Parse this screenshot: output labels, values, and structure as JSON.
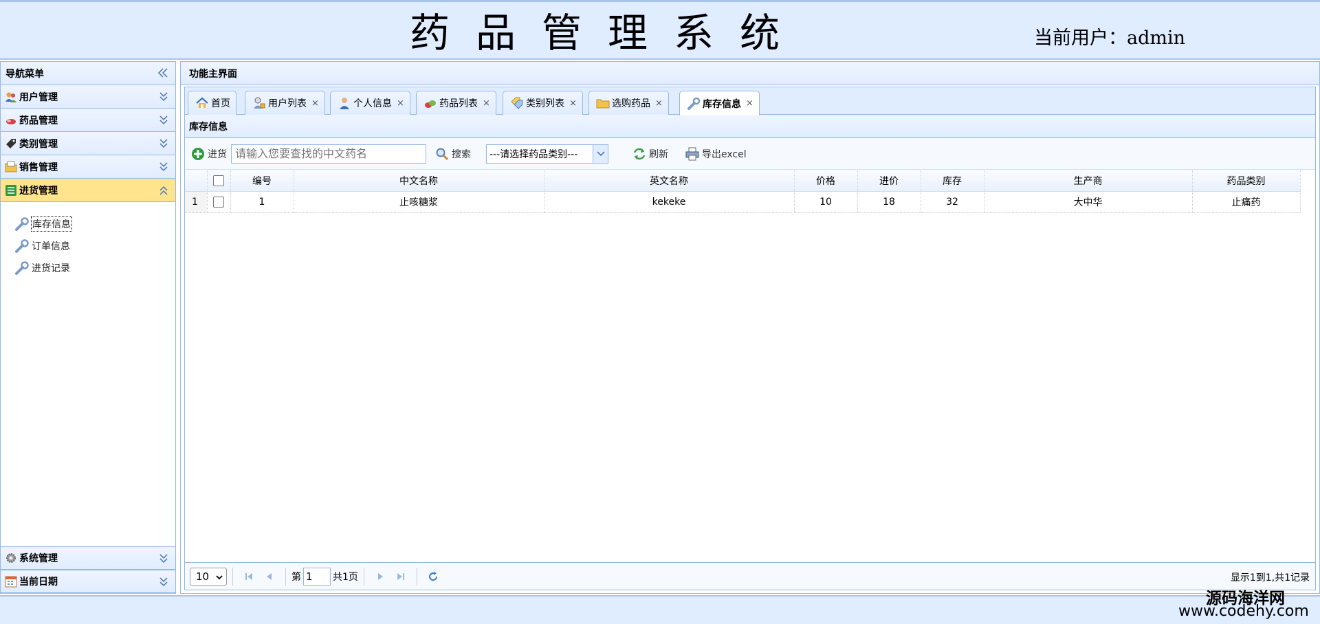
{
  "header": {
    "title": "药品管理系统",
    "current_user_label": "当前用户：admin"
  },
  "nav": {
    "title": "导航菜单",
    "groups": [
      {
        "label": "用户管理",
        "icon": "users-icon"
      },
      {
        "label": "药品管理",
        "icon": "pill-icon"
      },
      {
        "label": "类别管理",
        "icon": "tag-icon"
      },
      {
        "label": "销售管理",
        "icon": "folder-icon"
      },
      {
        "label": "进货管理",
        "icon": "list-icon",
        "active": true
      }
    ],
    "sub_items": [
      {
        "label": "库存信息",
        "icon": "wrench-icon",
        "selected": true
      },
      {
        "label": "订单信息",
        "icon": "wrench-icon"
      },
      {
        "label": "进货记录",
        "icon": "wrench-icon"
      }
    ],
    "bottom_groups": [
      {
        "label": "系统管理",
        "icon": "gear-icon"
      },
      {
        "label": "当前日期",
        "icon": "calendar-icon"
      }
    ]
  },
  "main": {
    "title": "功能主界面",
    "tabs": [
      {
        "label": "首页",
        "icon": "home-icon",
        "closable": false
      },
      {
        "label": "用户列表",
        "icon": "user-lock-icon",
        "closable": true
      },
      {
        "label": "个人信息",
        "icon": "person-icon",
        "closable": true
      },
      {
        "label": "药品列表",
        "icon": "pills-icon",
        "closable": true
      },
      {
        "label": "类别列表",
        "icon": "tags-icon",
        "closable": true
      },
      {
        "label": "选购药品",
        "icon": "folder-icon",
        "closable": true
      },
      {
        "label": "库存信息",
        "icon": "wrench-icon",
        "closable": true,
        "active": true
      }
    ],
    "close_glyph": "×",
    "panel_title": "库存信息",
    "toolbar": {
      "add_label": "进货",
      "search_placeholder": "请输入您要查找的中文药名",
      "search_label": "搜索",
      "category_select": "---请选择药品类别---",
      "refresh_label": "刷新",
      "export_label": "导出excel"
    },
    "table": {
      "columns": [
        "编号",
        "中文名称",
        "英文名称",
        "价格",
        "进价",
        "库存",
        "生产商",
        "药品类别"
      ],
      "rows": [
        {
          "rownum": "1",
          "cells": [
            "1",
            "止咳糖浆",
            "kekeke",
            "10",
            "18",
            "32",
            "大中华",
            "止痛药"
          ]
        }
      ]
    },
    "pager": {
      "page_size": "10",
      "page_prefix": "第",
      "page_value": "1",
      "page_total": "共1页",
      "info": "显示1到1,共1记录"
    }
  },
  "watermark": {
    "line1": "源码海洋网",
    "line2": "www.codehy.com"
  }
}
